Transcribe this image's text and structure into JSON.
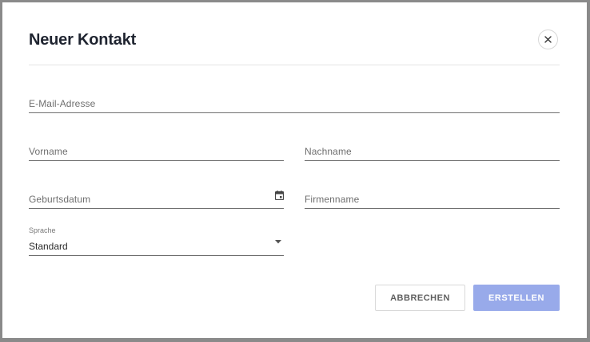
{
  "dialog": {
    "title": "Neuer Kontakt"
  },
  "fields": {
    "email_placeholder": "E-Mail-Adresse",
    "firstname_placeholder": "Vorname",
    "lastname_placeholder": "Nachname",
    "birthdate_placeholder": "Geburtsdatum",
    "company_placeholder": "Firmenname",
    "language_label": "Sprache",
    "language_value": "Standard"
  },
  "buttons": {
    "cancel_label": "ABBRECHEN",
    "create_label": "ERSTELLEN"
  },
  "icons": {
    "close": "close-icon",
    "calendar": "calendar-icon",
    "dropdown": "dropdown-arrow-icon"
  },
  "colors": {
    "primary_disabled": "#98aaea",
    "title": "#1f2430",
    "backdrop": "#8a8a8a"
  }
}
